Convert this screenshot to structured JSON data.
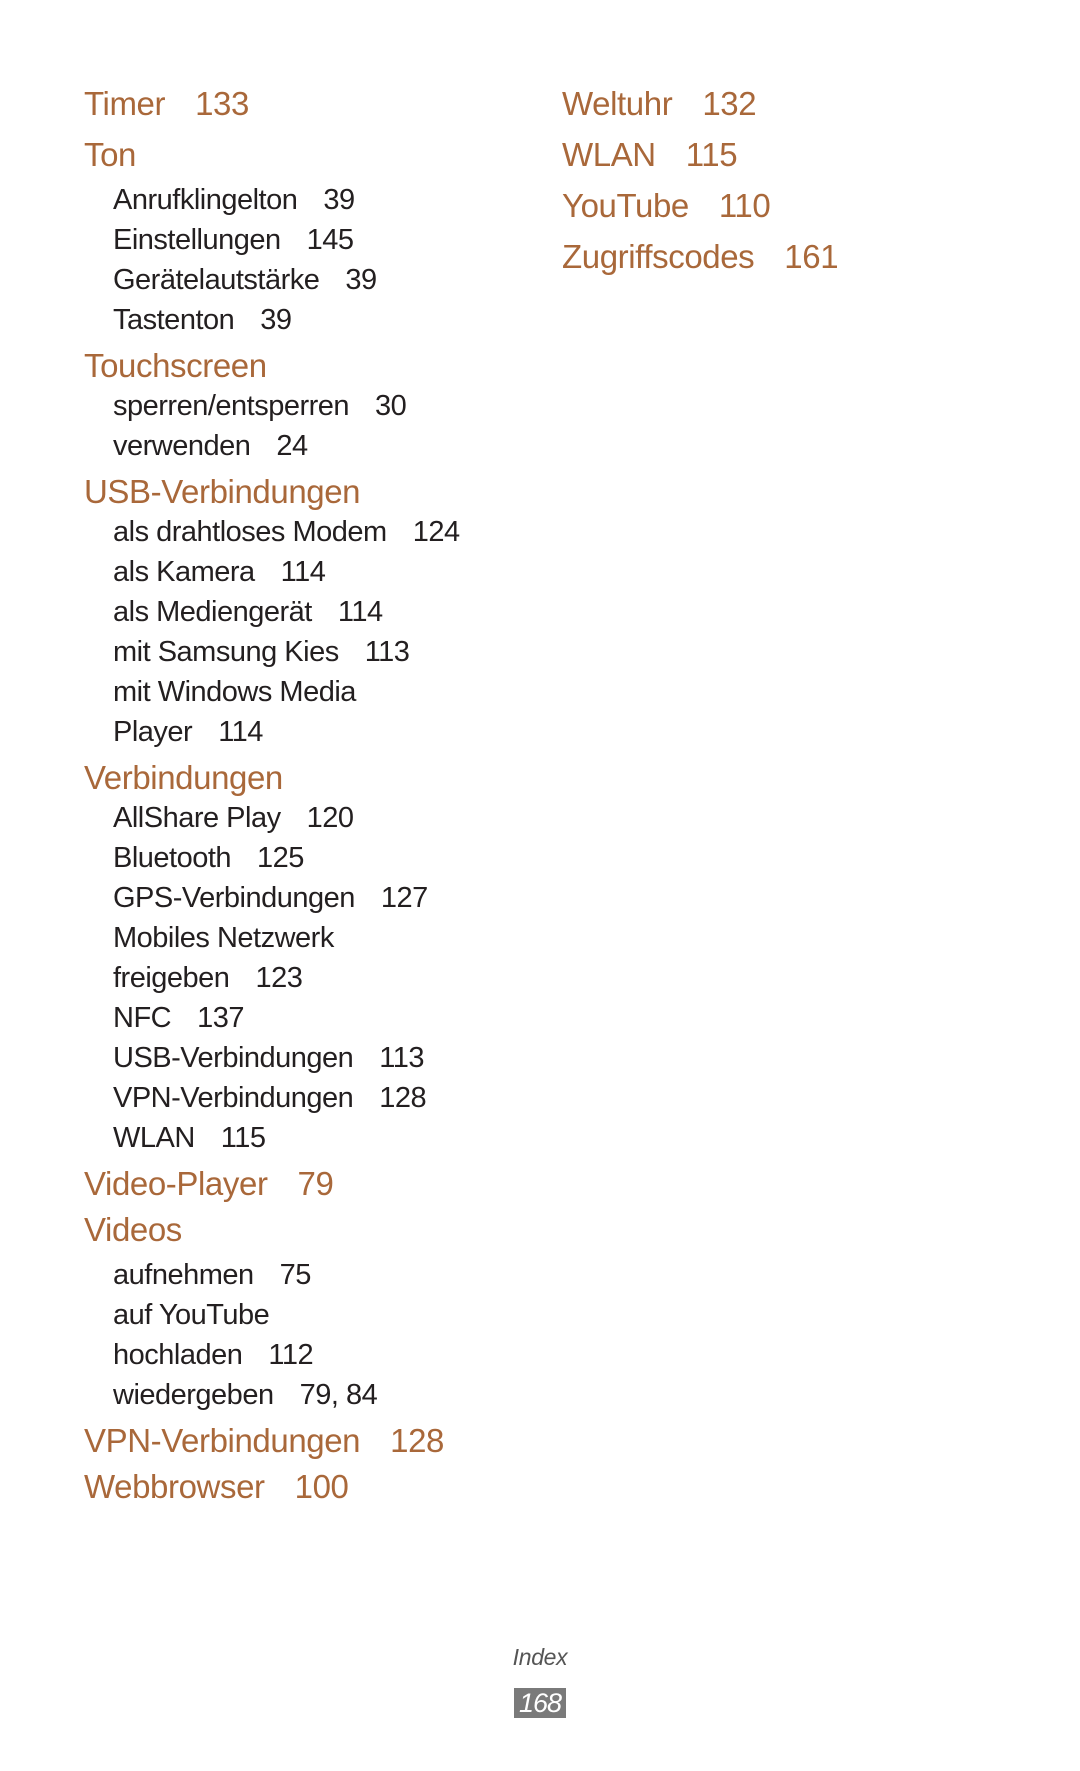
{
  "left_column": [
    {
      "type": "heading",
      "term": "Timer",
      "page": "133"
    },
    {
      "type": "heading",
      "term": "Ton",
      "page": ""
    },
    {
      "type": "sub",
      "term": "Anrufklingelton",
      "page": "39"
    },
    {
      "type": "sub",
      "term": "Einstellungen",
      "page": "145"
    },
    {
      "type": "sub",
      "term": "Gerätelautstärke",
      "page": "39"
    },
    {
      "type": "sub",
      "term": "Tastenton",
      "page": "39"
    },
    {
      "type": "heading",
      "term": "Touchscreen",
      "page": ""
    },
    {
      "type": "sub",
      "term": "sperren/entsperren",
      "page": "30"
    },
    {
      "type": "sub",
      "term": "verwenden",
      "page": "24"
    },
    {
      "type": "heading",
      "term": "USB-Verbindungen",
      "page": ""
    },
    {
      "type": "sub",
      "term": "als drahtloses Modem",
      "page": "124"
    },
    {
      "type": "sub",
      "term": "als Kamera",
      "page": "114"
    },
    {
      "type": "sub",
      "term": "als Mediengerät",
      "page": "114"
    },
    {
      "type": "sub",
      "term": "mit Samsung Kies",
      "page": "113"
    },
    {
      "type": "sub",
      "term": "mit Windows Media",
      "page": ""
    },
    {
      "type": "sub",
      "term": "Player",
      "page": "114"
    },
    {
      "type": "heading",
      "term": "Verbindungen",
      "page": ""
    },
    {
      "type": "sub",
      "term": "AllShare Play",
      "page": "120"
    },
    {
      "type": "sub",
      "term": "Bluetooth",
      "page": "125"
    },
    {
      "type": "sub",
      "term": "GPS-Verbindungen",
      "page": "127"
    },
    {
      "type": "sub",
      "term": "Mobiles Netzwerk",
      "page": ""
    },
    {
      "type": "sub",
      "term": "freigeben",
      "page": "123"
    },
    {
      "type": "sub",
      "term": "NFC",
      "page": "137"
    },
    {
      "type": "sub",
      "term": "USB-Verbindungen",
      "page": "113"
    },
    {
      "type": "sub",
      "term": "VPN-Verbindungen",
      "page": "128"
    },
    {
      "type": "sub",
      "term": "WLAN",
      "page": "115"
    },
    {
      "type": "heading",
      "term": "Video-Player",
      "page": "79"
    },
    {
      "type": "heading",
      "term": "Videos",
      "page": ""
    },
    {
      "type": "sub",
      "term": "aufnehmen",
      "page": "75"
    },
    {
      "type": "sub",
      "term": "auf YouTube",
      "page": ""
    },
    {
      "type": "sub",
      "term": "hochladen",
      "page": "112"
    },
    {
      "type": "sub",
      "term": "wiedergeben",
      "page": "79, 84"
    },
    {
      "type": "heading",
      "term": "VPN-Verbindungen",
      "page": "128"
    },
    {
      "type": "heading",
      "term": "Webbrowser",
      "page": "100"
    }
  ],
  "right_column": [
    {
      "type": "heading",
      "term": "Weltuhr",
      "page": "132"
    },
    {
      "type": "heading",
      "term": "WLAN",
      "page": "115"
    },
    {
      "type": "heading",
      "term": "YouTube",
      "page": "110"
    },
    {
      "type": "heading",
      "term": "Zugriffscodes",
      "page": "161"
    }
  ],
  "footer": {
    "section": "Index",
    "page_number": "168"
  },
  "colors": {
    "heading": "#a9683a",
    "text": "#231f20",
    "page_box": "#7a7a7a"
  }
}
